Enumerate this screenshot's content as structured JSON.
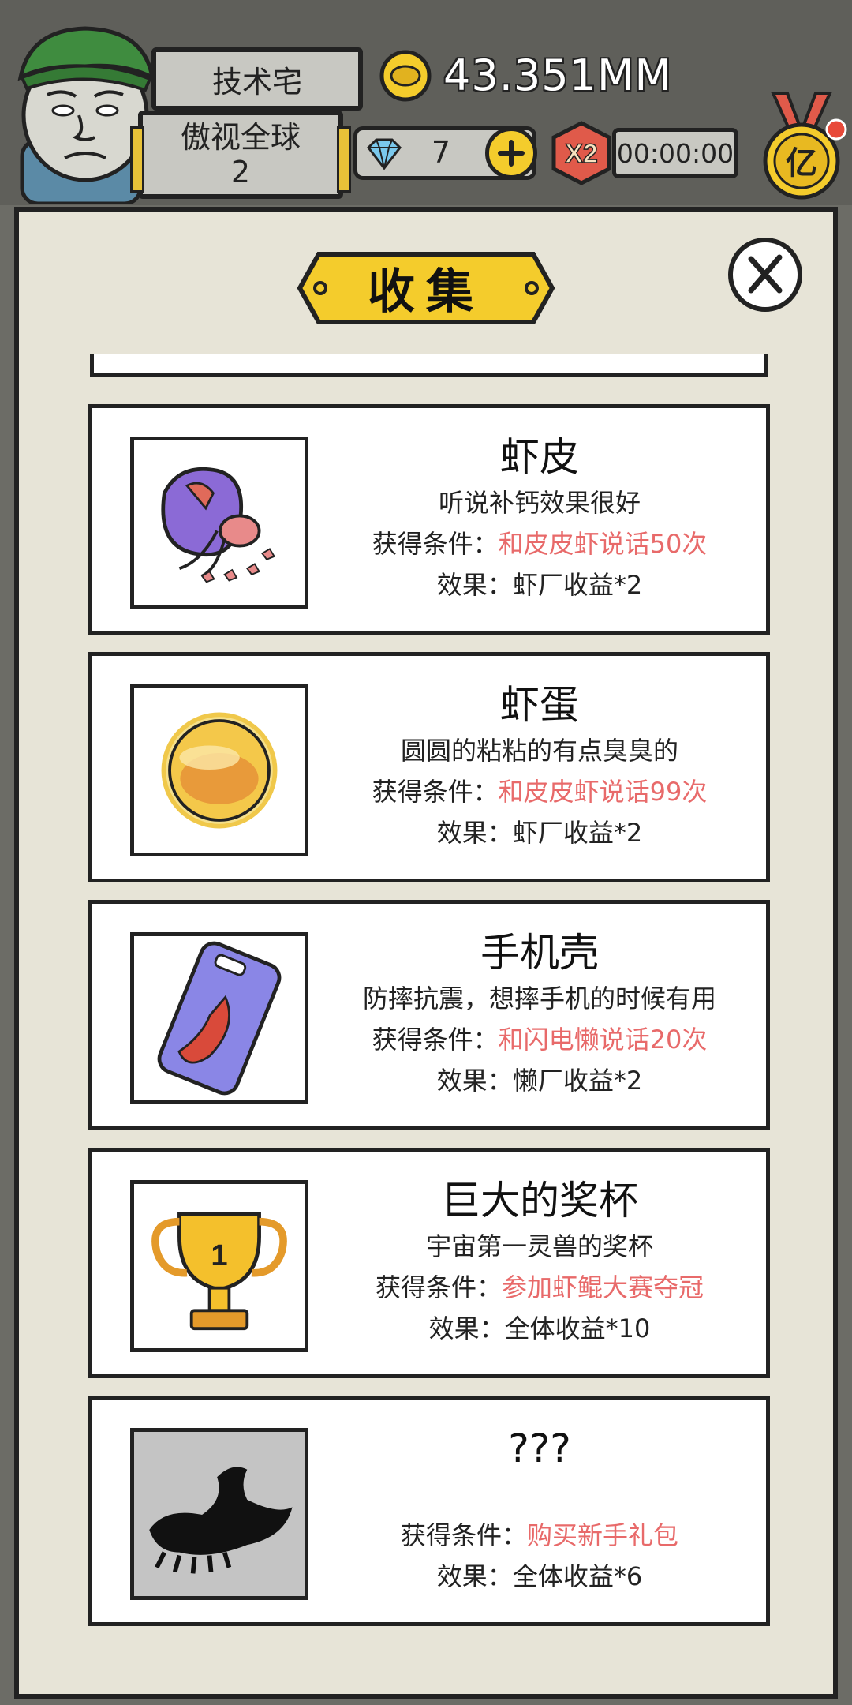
{
  "hud": {
    "player_name": "技术宅",
    "rank_title": "傲视全球",
    "rank_level": "2",
    "coins": "43.351MM",
    "gems": "7",
    "boost_label": "X2",
    "boost_timer": "00:00:00",
    "medal_label": "亿"
  },
  "panel": {
    "title": "收集",
    "condition_label": "获得条件：",
    "effect_label": "效果："
  },
  "items": [
    {
      "name": "虾皮",
      "desc": "听说补钙效果很好",
      "condition": "和皮皮虾说话50次",
      "effect": "虾厂收益*2",
      "icon": "shrimp-skin-bag-icon"
    },
    {
      "name": "虾蛋",
      "desc": "圆圆的粘粘的有点臭臭的",
      "condition": "和皮皮虾说话99次",
      "effect": "虾厂收益*2",
      "icon": "shrimp-egg-icon"
    },
    {
      "name": "手机壳",
      "desc": "防摔抗震，想摔手机的时候有用",
      "condition": "和闪电懒说话20次",
      "effect": "懒厂收益*2",
      "icon": "phone-case-icon"
    },
    {
      "name": "巨大的奖杯",
      "desc": "宇宙第一灵兽的奖杯",
      "condition": "参加虾鲲大赛夺冠",
      "effect": "全体收益*10",
      "icon": "trophy-icon"
    },
    {
      "name": "???",
      "desc": "",
      "condition": "购买新手礼包",
      "effect": "全体收益*6",
      "icon": "locked-silhouette-icon"
    }
  ],
  "colors": {
    "condition_text": "#e86a6a",
    "panel_bg": "#e7e4d7",
    "banner_yellow": "#f4cc2c"
  }
}
